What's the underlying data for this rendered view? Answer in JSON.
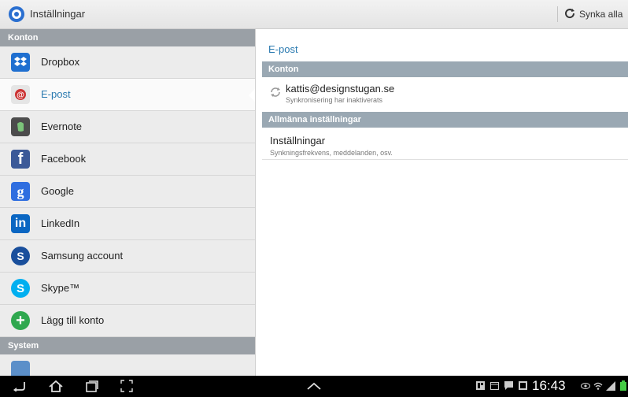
{
  "actionbar": {
    "title": "Inställningar",
    "sync_label": "Synka alla"
  },
  "left": {
    "section_accounts": "Konton",
    "section_system": "System",
    "items": [
      {
        "label": "Dropbox",
        "icon": "dropbox-icon",
        "color": "#1f6fd0"
      },
      {
        "label": "E-post",
        "icon": "email-icon",
        "color": "#d9d9d9",
        "selected": true
      },
      {
        "label": "Evernote",
        "icon": "evernote-icon",
        "color": "#4c4c4c"
      },
      {
        "label": "Facebook",
        "icon": "facebook-icon",
        "color": "#3b5998"
      },
      {
        "label": "Google",
        "icon": "google-icon",
        "color": "#2f6ee0"
      },
      {
        "label": "LinkedIn",
        "icon": "linkedin-icon",
        "color": "#0a66c2"
      },
      {
        "label": "Samsung account",
        "icon": "samsung-account-icon",
        "color": "#1a4f9c"
      },
      {
        "label": "Skype™",
        "icon": "skype-icon",
        "color": "#00aff0"
      },
      {
        "label": "Lägg till konto",
        "icon": "add-account-icon",
        "color": "#2fa84f"
      }
    ]
  },
  "right": {
    "title": "E-post",
    "section_accounts": "Konton",
    "account_email": "kattis@designstugan.se",
    "account_status": "Synkronisering har inaktiverats",
    "section_general": "Allmänna inställningar",
    "settings_title": "Inställningar",
    "settings_desc": "Synkningsfrekvens, meddelanden, osv."
  },
  "navbar": {
    "time": "16:43"
  },
  "colors": {
    "accent": "#2a7ab0",
    "section_header": "#9aa0a6"
  }
}
